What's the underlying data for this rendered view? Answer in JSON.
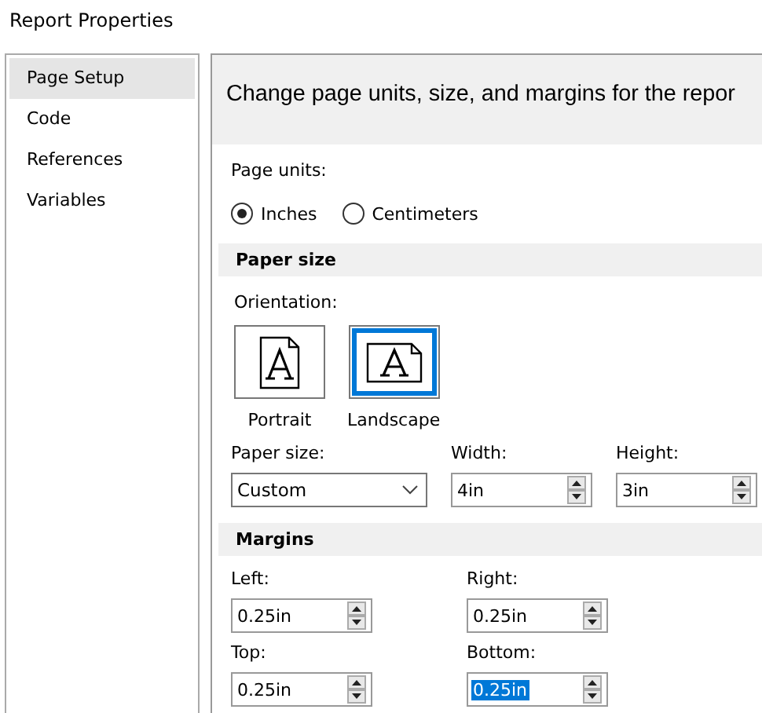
{
  "window": {
    "title": "Report Properties"
  },
  "sidebar": {
    "items": [
      {
        "label": "Page Setup",
        "selected": true
      },
      {
        "label": "Code",
        "selected": false
      },
      {
        "label": "References",
        "selected": false
      },
      {
        "label": "Variables",
        "selected": false
      }
    ]
  },
  "header": "Change page units, size, and margins for the repor",
  "page_units": {
    "label": "Page units:",
    "options": [
      {
        "label": "Inches",
        "selected": true
      },
      {
        "label": "Centimeters",
        "selected": false
      }
    ]
  },
  "paper_size": {
    "heading": "Paper size",
    "orientation_label": "Orientation:",
    "orientations": [
      {
        "label": "Portrait",
        "kind": "portrait",
        "selected": false
      },
      {
        "label": "Landscape",
        "kind": "landscape",
        "selected": true
      }
    ],
    "size": {
      "label": "Paper size:",
      "value": "Custom"
    },
    "width": {
      "label": "Width:",
      "value": "4in"
    },
    "height": {
      "label": "Height:",
      "value": "3in"
    }
  },
  "margins": {
    "heading": "Margins",
    "fields": [
      {
        "label": "Left:",
        "value": "0.25in",
        "selected": false
      },
      {
        "label": "Right:",
        "value": "0.25in",
        "selected": false
      },
      {
        "label": "Top:",
        "value": "0.25in",
        "selected": false
      },
      {
        "label": "Bottom:",
        "value": "0.25in",
        "selected": true
      }
    ]
  }
}
